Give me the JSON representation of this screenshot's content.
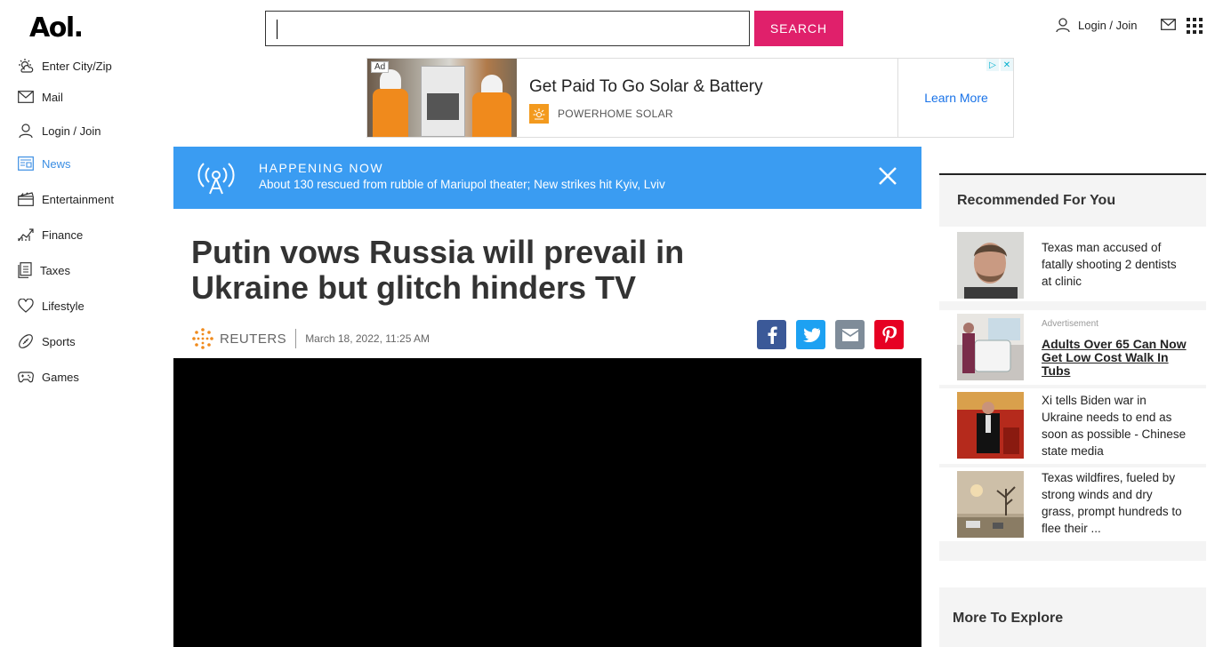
{
  "header": {
    "logo": "Aol.",
    "search_button": "SEARCH",
    "login_label": "Login / Join"
  },
  "sidebar": {
    "items": [
      {
        "label": "Enter City/Zip",
        "icon": "weather-icon"
      },
      {
        "label": "Mail",
        "icon": "mail-icon"
      },
      {
        "label": "Login / Join",
        "icon": "user-icon"
      },
      {
        "label": "News",
        "icon": "news-icon",
        "active": true
      },
      {
        "label": "Entertainment",
        "icon": "clapper-icon"
      },
      {
        "label": "Finance",
        "icon": "chart-icon"
      },
      {
        "label": "Taxes",
        "icon": "document-icon"
      },
      {
        "label": "Lifestyle",
        "icon": "heart-icon"
      },
      {
        "label": "Sports",
        "icon": "football-icon"
      },
      {
        "label": "Games",
        "icon": "gamepad-icon"
      }
    ],
    "active_color": "#3b8ee3"
  },
  "ad": {
    "tag": "Ad",
    "title": "Get Paid To Go Solar & Battery",
    "brand": "POWERHOME SOLAR",
    "cta": "Learn More"
  },
  "happening": {
    "label": "HAPPENING NOW",
    "text": "About 130 rescued from rubble of Mariupol theater; New strikes hit Kyiv, Lviv",
    "color": "#3a9cf2"
  },
  "article": {
    "headline": "Putin vows Russia will prevail in Ukraine but glitch hinders TV",
    "source": "REUTERS",
    "date": "March 18, 2022, 11:25 AM"
  },
  "share": {
    "facebook_color": "#3b5998",
    "twitter_color": "#1da1f2",
    "email_color": "#7f8c99",
    "pinterest_color": "#e60023"
  },
  "rail": {
    "title": "Recommended For You",
    "items": [
      {
        "text": "Texas man accused of fatally shooting 2 dentists at clinic"
      },
      {
        "ad_label": "Advertisement",
        "text": "Adults Over 65 Can Now Get Low Cost Walk In Tubs"
      },
      {
        "text": "Xi tells Biden war in Ukraine needs to end as soon as possible - Chinese state media"
      },
      {
        "text": "Texas wildfires, fueled by strong winds and dry grass, prompt hundreds to flee their ..."
      }
    ]
  },
  "explore": {
    "title": "More To Explore"
  },
  "colors": {
    "search_button": "#e0206b"
  }
}
